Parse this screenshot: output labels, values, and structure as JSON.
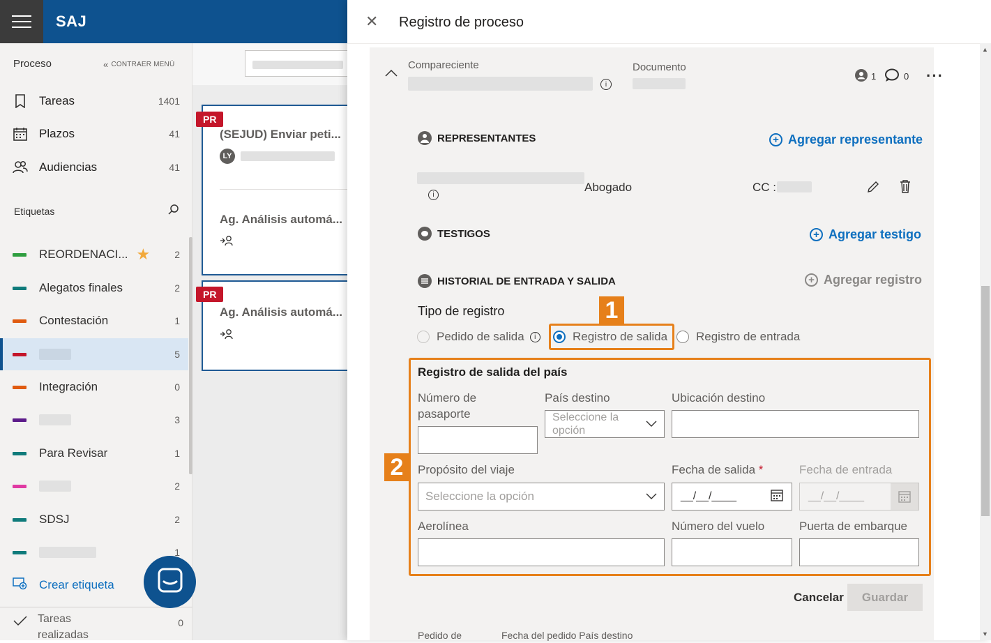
{
  "app": {
    "logo": "SAJ"
  },
  "sidebar": {
    "title": "Proceso",
    "collapse_label": "CONTRAER MENÚ",
    "nav": [
      {
        "label": "Tareas",
        "count": "1401",
        "icon": "bookmark-icon"
      },
      {
        "label": "Plazos",
        "count": "41",
        "icon": "calendar-icon"
      },
      {
        "label": "Audiencias",
        "count": "41",
        "icon": "people-icon"
      }
    ],
    "tags_title": "Etiquetas",
    "tags": [
      {
        "label": "REORDENACI...",
        "count": "2",
        "color": "#2e9e3f",
        "starred": true
      },
      {
        "label": "Alegatos finales",
        "count": "2",
        "color": "#0f7b7b"
      },
      {
        "label": "Contestación",
        "count": "1",
        "color": "#e05b10"
      },
      {
        "label": "",
        "count": "5",
        "color": "#c4162a",
        "selected": true
      },
      {
        "label": "Integración",
        "count": "0",
        "color": "#e05b10"
      },
      {
        "label": "",
        "count": "3",
        "color": "#5c1b8a"
      },
      {
        "label": "Para Revisar",
        "count": "1",
        "color": "#0f7b7b"
      },
      {
        "label": "",
        "count": "2",
        "color": "#e03aa3"
      },
      {
        "label": "SDSJ",
        "count": "2",
        "color": "#0f7b7b"
      },
      {
        "label": "",
        "count": "1",
        "color": "#0f7b7b"
      }
    ],
    "create_tag": "Crear etiqueta",
    "done_label": "Tareas realizadas",
    "done_count": "0"
  },
  "list": {
    "cards": [
      {
        "flag": "PR",
        "title": "(SEJUD) Enviar peti...",
        "avatar": "LY",
        "title2": "Ag. Análisis automá..."
      },
      {
        "flag": "PR",
        "title": "Ag. Análisis automá..."
      }
    ]
  },
  "panel": {
    "title": "Registro de proceso",
    "compareciente_label": "Compareciente",
    "documento_label": "Documento",
    "persons_count": "1",
    "comments_count": "0",
    "representantes": "REPRESENTANTES",
    "add_representante": "Agregar representante",
    "rep_role": "Abogado",
    "rep_cc": "CC :",
    "testigos": "TESTIGOS",
    "add_testigo": "Agregar testigo",
    "historial": "HISTORIAL DE ENTRADA Y SALIDA",
    "add_registro": "Agregar registro",
    "tipo_registro": "Tipo de registro",
    "radios": [
      "Pedido de salida",
      "Registro de salida",
      "Registro de entrada"
    ],
    "badge1": "1",
    "badge2": "2",
    "form": {
      "title": "Registro de salida del país",
      "pasaporte": "Número de pasaporte",
      "pais": "País destino",
      "pais_placeholder": "Seleccione la opción",
      "ubicacion": "Ubicación destino",
      "proposito": "Propósito del viaje",
      "proposito_placeholder": "Seleccione la opción",
      "fecha_salida": "Fecha de salida",
      "required": "*",
      "fecha_salida_value": "__/__/____",
      "fecha_entrada": "Fecha de entrada",
      "fecha_entrada_value": "__/__/____",
      "aerolinea": "Aerolínea",
      "vuelo": "Número del vuelo",
      "puerta": "Puerta de embarque"
    },
    "cancel": "Cancelar",
    "save": "Guardar",
    "footer_col1": "Pedido de",
    "footer_col2": "Fecha del pedido País destino"
  }
}
